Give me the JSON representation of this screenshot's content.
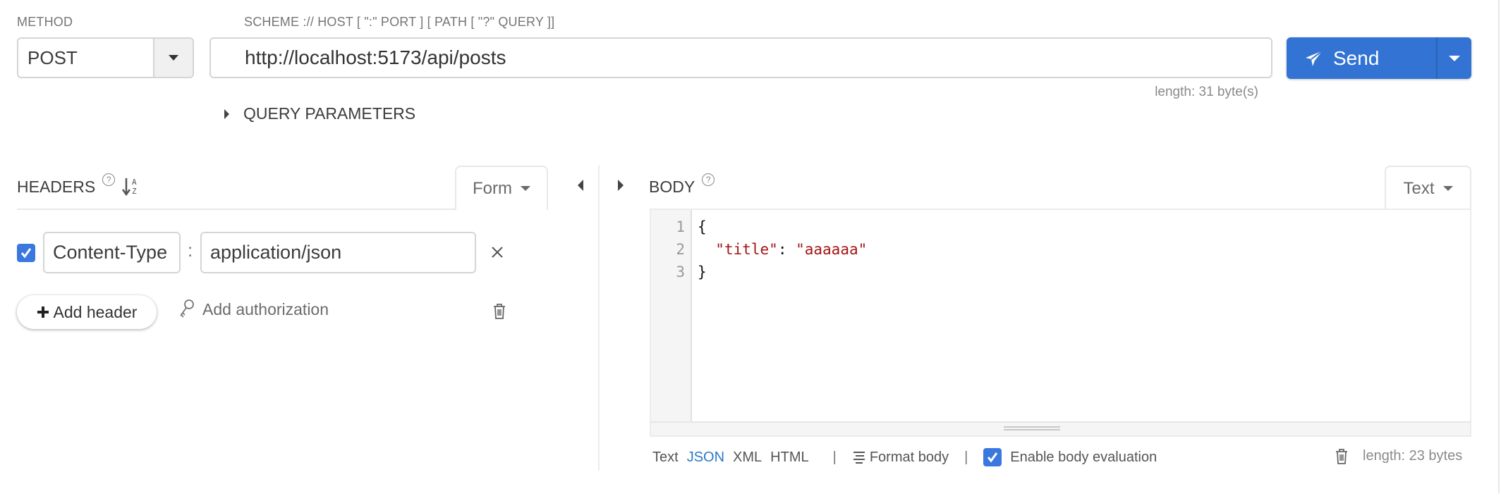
{
  "request": {
    "method_label": "METHOD",
    "method_value": "POST",
    "url_label": "SCHEME :// HOST [ \":\" PORT ] [ PATH [ \"?\" QUERY ]]",
    "url_value": "http://localhost:5173/api/posts",
    "url_length": "length: 31 byte(s)",
    "send_label": "Send",
    "query_parameters_label": "QUERY PARAMETERS"
  },
  "headers": {
    "title": "HEADERS",
    "help": "?",
    "sort_icon": "sort-alpha-icon",
    "mode_tab": "Form",
    "rows": [
      {
        "enabled": true,
        "key": "Content-Type",
        "separator": ":",
        "value": "application/json"
      }
    ],
    "add_header_label": "Add header",
    "add_authorization_label": "Add authorization"
  },
  "body": {
    "title": "BODY",
    "help": "?",
    "mode_tab": "Text",
    "lines": [
      {
        "n": "1",
        "open": "{"
      },
      {
        "n": "2",
        "key": "\"title\"",
        "colon": ": ",
        "value": "\"aaaaaa\""
      },
      {
        "n": "3",
        "close": "}"
      }
    ],
    "formats": [
      "Text",
      "JSON",
      "XML",
      "HTML"
    ],
    "active_format": "JSON",
    "separator": "|",
    "format_body_label": "Format body",
    "enable_eval_label": "Enable body evaluation",
    "enable_eval_checked": true,
    "length": "length: 23 bytes"
  },
  "colors": {
    "accent": "#3273d3",
    "checkbox": "#3a78e0",
    "json_string": "#a31515",
    "active_format": "#2a7ac7"
  }
}
